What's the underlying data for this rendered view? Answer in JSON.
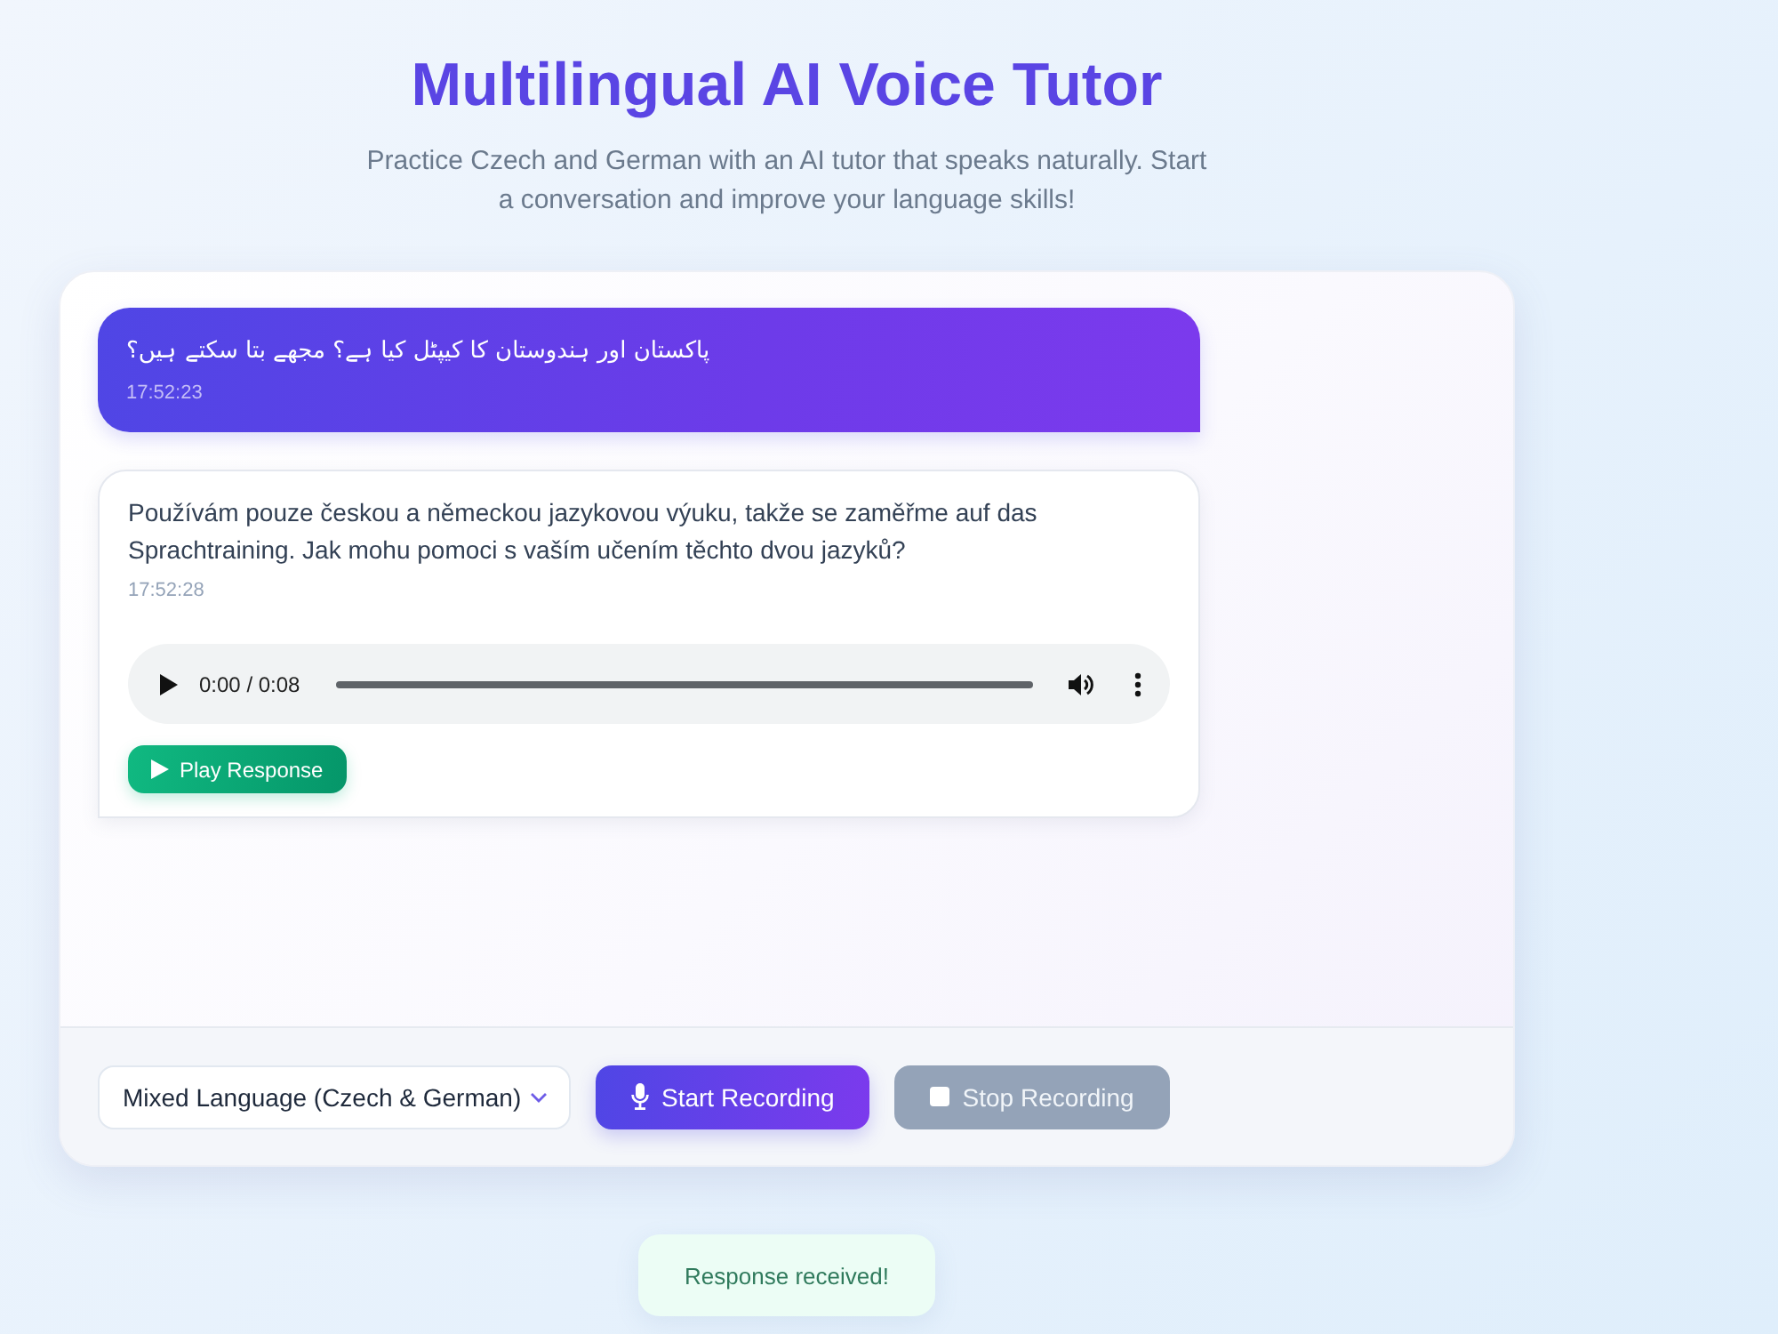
{
  "header": {
    "title": "Multilingual AI Voice Tutor",
    "subtitle": "Practice Czech and German with an AI tutor that speaks naturally. Start a conversation and improve your language skills!"
  },
  "messages": [
    {
      "kind": "user",
      "text": "پاکستان اور ہندوستان کا کیپٹل کیا ہے؟ مجھے بتا سکتے ہیں؟",
      "time": "17:52:23"
    },
    {
      "kind": "tutor",
      "text": "Používám pouze českou a německou jazykovou výuku, takže se zaměřme auf das Sprachtraining. Jak mohu pomoci s vaším učením těchto dvou jazyků?",
      "time": "17:52:28",
      "audio": {
        "time": "0:00 / 0:08"
      },
      "play_button": "Play Response"
    }
  ],
  "controls": {
    "language_select": {
      "value": "Mixed Language (Czech & German)"
    },
    "buttons": [
      {
        "kind": "start",
        "label": "Start Recording",
        "disabled": false
      },
      {
        "kind": "stop",
        "label": "Stop Recording",
        "disabled": true
      }
    ]
  },
  "toast": {
    "text": "Response received!"
  }
}
